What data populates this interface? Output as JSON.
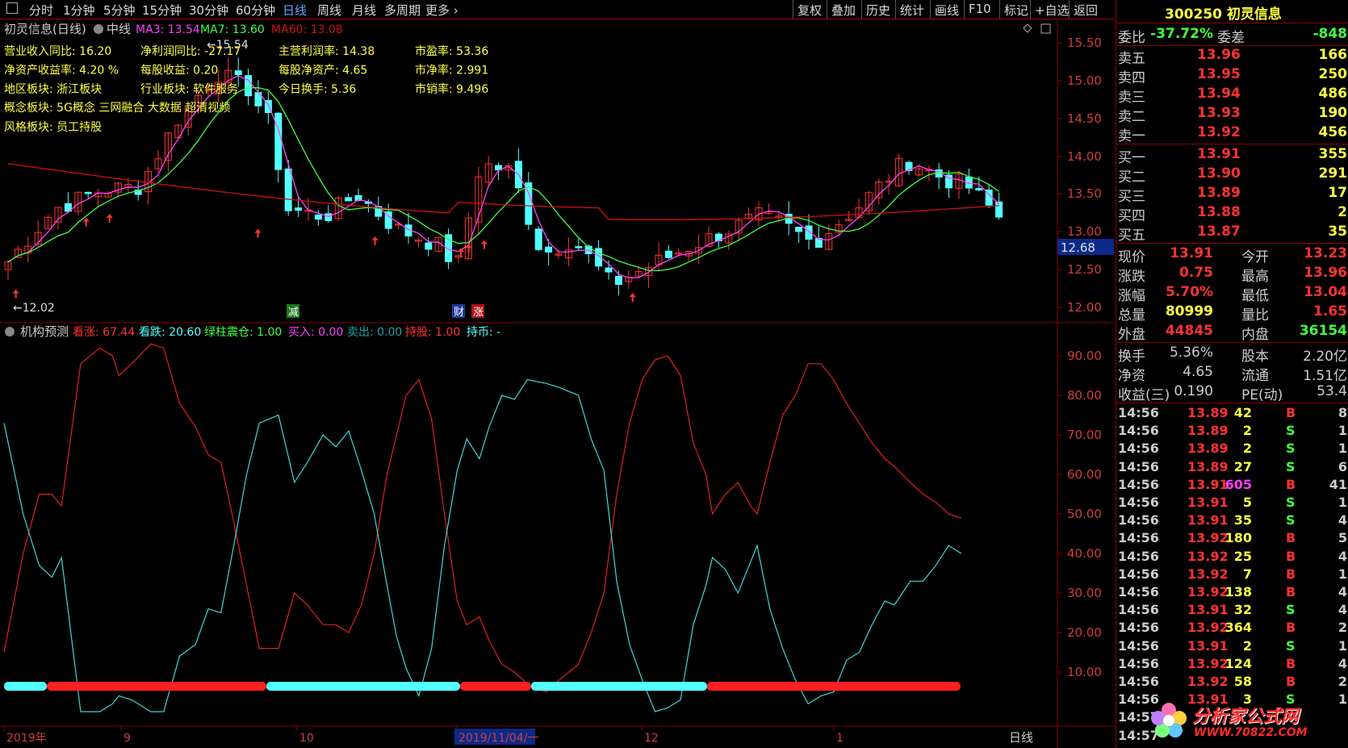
{
  "toolbar": {
    "left": [
      "分时",
      "1分钟",
      "5分钟",
      "15分钟",
      "30分钟",
      "60分钟",
      "日线",
      "周线",
      "月线",
      "多周期",
      "更多"
    ],
    "right": [
      "复权",
      "叠加",
      "历史",
      "统计",
      "画线",
      "F10",
      "标记",
      "+自选",
      "返回"
    ],
    "active": "日线"
  },
  "main": {
    "title": "初灵信息(日线)",
    "indicator": "中线",
    "ma3": "MA3: 13.54",
    "ma7": "MA7: 13.60",
    "ma60": "MA60: 13.08",
    "fund": [
      [
        "营业收入同比: 16.20",
        "净利润同比: -27.17",
        "主营利润率: 14.38",
        "市盈率: 53.36"
      ],
      [
        "净资产收益率: 4.20 %",
        "每股收益: 0.20",
        "每股净资产: 4.65",
        "市净率: 2.991"
      ],
      [
        "地区板块: 浙江板块",
        "行业板块: 软件服务",
        "今日换手: 5.36",
        "市销率: 9.496"
      ]
    ],
    "concept": "概念板块: 5G概念 三网融合 大数据 超清视频",
    "style": "风格板块: 员工持股",
    "high_mark": "←15.54",
    "low_mark": "←12.02",
    "current_tag": "12.68",
    "yaxis": [
      "15.50",
      "15.00",
      "14.50",
      "14.00",
      "13.50",
      "13.00",
      "12.50",
      "12.00"
    ],
    "markers": [
      "减",
      "财",
      "涨"
    ]
  },
  "sub": {
    "title": "机构预测",
    "items": [
      "看涨: 67.44",
      "看跌: 20.60",
      "绿柱震仓: 1.00",
      "买入: 0.00",
      "卖出: 0.00",
      "持股: 1.00",
      "持币: -"
    ],
    "yaxis": [
      "90.00",
      "80.00",
      "70.00",
      "60.00",
      "50.00",
      "40.00",
      "30.00",
      "20.00",
      "10.00"
    ]
  },
  "xaxis": {
    "labels": [
      "2019年",
      "9",
      "10",
      "2019/11/04/一",
      "12",
      "1"
    ],
    "period": "日线"
  },
  "side": {
    "code": "300250 初灵信息",
    "webi": [
      "委比",
      "-37.72%",
      "委差",
      "-848"
    ],
    "asks": [
      [
        "卖五",
        "13.96",
        "166"
      ],
      [
        "卖四",
        "13.95",
        "250"
      ],
      [
        "卖三",
        "13.94",
        "486"
      ],
      [
        "卖二",
        "13.93",
        "190"
      ],
      [
        "卖一",
        "13.92",
        "456"
      ]
    ],
    "bids": [
      [
        "买一",
        "13.91",
        "355"
      ],
      [
        "买二",
        "13.90",
        "291"
      ],
      [
        "买三",
        "13.89",
        "17"
      ],
      [
        "买四",
        "13.88",
        "2"
      ],
      [
        "买五",
        "13.87",
        "35"
      ]
    ],
    "quote": [
      [
        "现价",
        "13.91",
        "今开",
        "13.23"
      ],
      [
        "涨跌",
        "0.75",
        "最高",
        "13.96"
      ],
      [
        "涨幅",
        "5.70%",
        "最低",
        "13.04"
      ],
      [
        "总量",
        "80999",
        "量比",
        "1.65"
      ],
      [
        "外盘",
        "44845",
        "内盘",
        "36154"
      ]
    ],
    "stats": [
      [
        "换手",
        "5.36%",
        "股本",
        "2.20亿"
      ],
      [
        "净资",
        "4.65",
        "流通",
        "1.51亿"
      ],
      [
        "收益(三)",
        "0.190",
        "PE(动)",
        "53.4"
      ]
    ],
    "ticks": [
      [
        "14:56",
        "13.89",
        "42",
        "B",
        "8"
      ],
      [
        "14:56",
        "13.89",
        "2",
        "S",
        "1"
      ],
      [
        "14:56",
        "13.89",
        "2",
        "S",
        "1"
      ],
      [
        "14:56",
        "13.89",
        "27",
        "S",
        "6"
      ],
      [
        "14:56",
        "13.91",
        "605",
        "B",
        "41"
      ],
      [
        "14:56",
        "13.91",
        "5",
        "S",
        "1"
      ],
      [
        "14:56",
        "13.91",
        "35",
        "S",
        "4"
      ],
      [
        "14:56",
        "13.92",
        "180",
        "B",
        "5"
      ],
      [
        "14:56",
        "13.92",
        "25",
        "B",
        "4"
      ],
      [
        "14:56",
        "13.92",
        "7",
        "B",
        "1"
      ],
      [
        "14:56",
        "13.92",
        "138",
        "B",
        "4"
      ],
      [
        "14:56",
        "13.91",
        "32",
        "S",
        "4"
      ],
      [
        "14:56",
        "13.92",
        "364",
        "B",
        "2"
      ],
      [
        "14:56",
        "13.91",
        "2",
        "S",
        "1"
      ],
      [
        "14:56",
        "13.92",
        "124",
        "B",
        "4"
      ],
      [
        "14:56",
        "13.92",
        "58",
        "B",
        "2"
      ],
      [
        "14:56",
        "13.91",
        "3",
        "S",
        "1"
      ],
      [
        "14:57",
        "",
        "",
        "",
        ""
      ],
      [
        "14:57",
        "",
        "",
        "",
        ""
      ]
    ],
    "watermark": "分析家公式网",
    "watermark_url": "WWW.70822.COM"
  },
  "colors": {
    "up": "#ff3232",
    "down": "#54ffff",
    "ma3": "#ff40ff",
    "ma7": "#40ff40",
    "ma60": "#d01010",
    "grid": "#8b0000",
    "yellow": "#ffff40"
  }
}
